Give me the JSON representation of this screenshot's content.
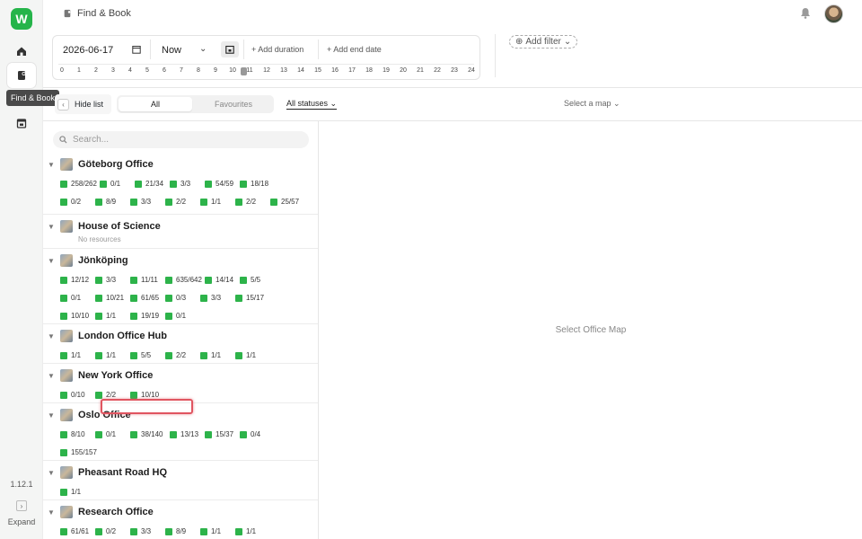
{
  "app": {
    "logo_letter": "W",
    "nav_tooltip": "Find & Book",
    "version": "1.12.1",
    "expand_label": "Expand",
    "breadcrumb": "Find & Book",
    "brand_color": "#25b44a"
  },
  "filters": {
    "date": "2026-06-17",
    "time": "Now",
    "add_duration": "Add duration",
    "add_end_date": "Add end date",
    "hours": [
      "0",
      "1",
      "2",
      "3",
      "4",
      "5",
      "6",
      "7",
      "8",
      "9",
      "10",
      "11",
      "12",
      "13",
      "14",
      "15",
      "16",
      "17",
      "18",
      "19",
      "20",
      "21",
      "22",
      "23",
      "24"
    ],
    "add_filter": "Add filter"
  },
  "toolbar": {
    "hide_list": "Hide list",
    "tab_all": "All",
    "tab_favourites": "Favourites",
    "status_filter": "All statuses",
    "map_select": "Select a map"
  },
  "search": {
    "placeholder": "Search..."
  },
  "offices": [
    {
      "name": "Göteborg Office",
      "rows": [
        [
          "258/262",
          "0/1",
          "21/34",
          "3/3",
          "54/59",
          "18/18"
        ],
        [
          "0/2",
          "8/9",
          "3/3",
          "2/2",
          "1/1",
          "2/2",
          "25/57"
        ]
      ]
    },
    {
      "name": "House of Science",
      "subtitle": "No resources",
      "rows": []
    },
    {
      "name": "Jönköping",
      "rows": [
        [
          "12/12",
          "3/3",
          "11/11",
          "635/642",
          "14/14",
          "5/5"
        ],
        [
          "0/1",
          "10/21",
          "61/65",
          "0/3",
          "3/3",
          "15/17"
        ],
        [
          "10/10",
          "1/1",
          "19/19",
          "0/1"
        ]
      ]
    },
    {
      "name": "London Office Hub",
      "rows": [
        [
          "1/1",
          "1/1",
          "5/5",
          "2/2",
          "1/1",
          "1/1"
        ]
      ]
    },
    {
      "name": "New York Office",
      "rows": [
        [
          "0/10",
          "2/2",
          "10/10"
        ]
      ]
    },
    {
      "name": "Oslo Office",
      "rows": [
        [
          "8/10",
          "0/1",
          "38/140",
          "13/13",
          "15/37",
          "0/4"
        ],
        [
          "155/157"
        ]
      ]
    },
    {
      "name": "Pheasant Road HQ",
      "rows": [
        [
          "1/1"
        ]
      ]
    },
    {
      "name": "Research Office",
      "rows": [
        [
          "61/61",
          "0/2",
          "3/3",
          "8/9",
          "1/1",
          "1/1"
        ]
      ]
    }
  ],
  "map": {
    "placeholder": "Select Office Map"
  }
}
